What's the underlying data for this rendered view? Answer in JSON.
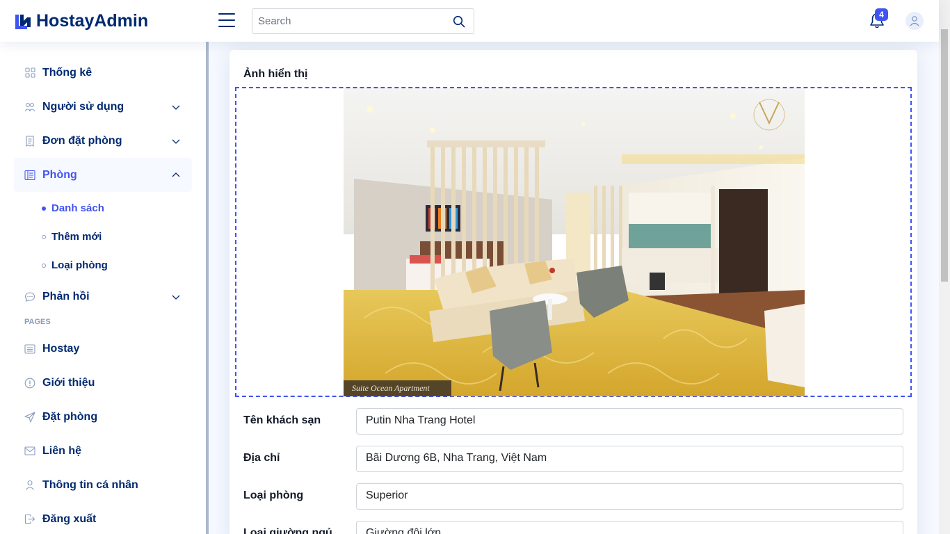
{
  "header": {
    "brand": "HostayAdmin",
    "search_placeholder": "Search",
    "notification_count": "4"
  },
  "sidebar": {
    "items": [
      {
        "label": "Thống kê",
        "icon": "grid-icon"
      },
      {
        "label": "Người sử dụng",
        "icon": "people-icon"
      },
      {
        "label": "Đơn đặt phòng",
        "icon": "receipt-icon"
      },
      {
        "label": "Phòng",
        "icon": "layout-text-icon"
      },
      {
        "label": "Phản hồi",
        "icon": "chat-icon"
      }
    ],
    "submenu": [
      {
        "label": "Danh sách",
        "active": true
      },
      {
        "label": "Thêm mới",
        "active": false
      },
      {
        "label": "Loại phòng",
        "active": false
      }
    ],
    "pages_heading": "PAGES",
    "pages": [
      {
        "label": "Hostay",
        "icon": "card-list-icon"
      },
      {
        "label": "Giới thiệu",
        "icon": "info-circle-icon"
      },
      {
        "label": "Đặt phòng",
        "icon": "send-icon"
      },
      {
        "label": "Liên hệ",
        "icon": "envelope-icon"
      },
      {
        "label": "Thông tin cá nhân",
        "icon": "person-icon"
      },
      {
        "label": "Đăng xuất",
        "icon": "box-arrow-right-icon"
      }
    ]
  },
  "main": {
    "image_title": "Ảnh hiển thị",
    "photo_caption": "Suite Ocean Apartment",
    "fields": [
      {
        "label": "Tên khách sạn",
        "value": "Putin Nha Trang Hotel"
      },
      {
        "label": "Địa chỉ",
        "value": "Bãi Dương 6B, Nha Trang, Việt Nam"
      },
      {
        "label": "Loại phòng",
        "value": "Superior"
      },
      {
        "label": "Loại giường ngủ",
        "value": "Giường đôi lớn"
      }
    ]
  },
  "colors": {
    "accent": "#4154f1",
    "nav_text": "#012970",
    "background": "#f6f9ff"
  }
}
